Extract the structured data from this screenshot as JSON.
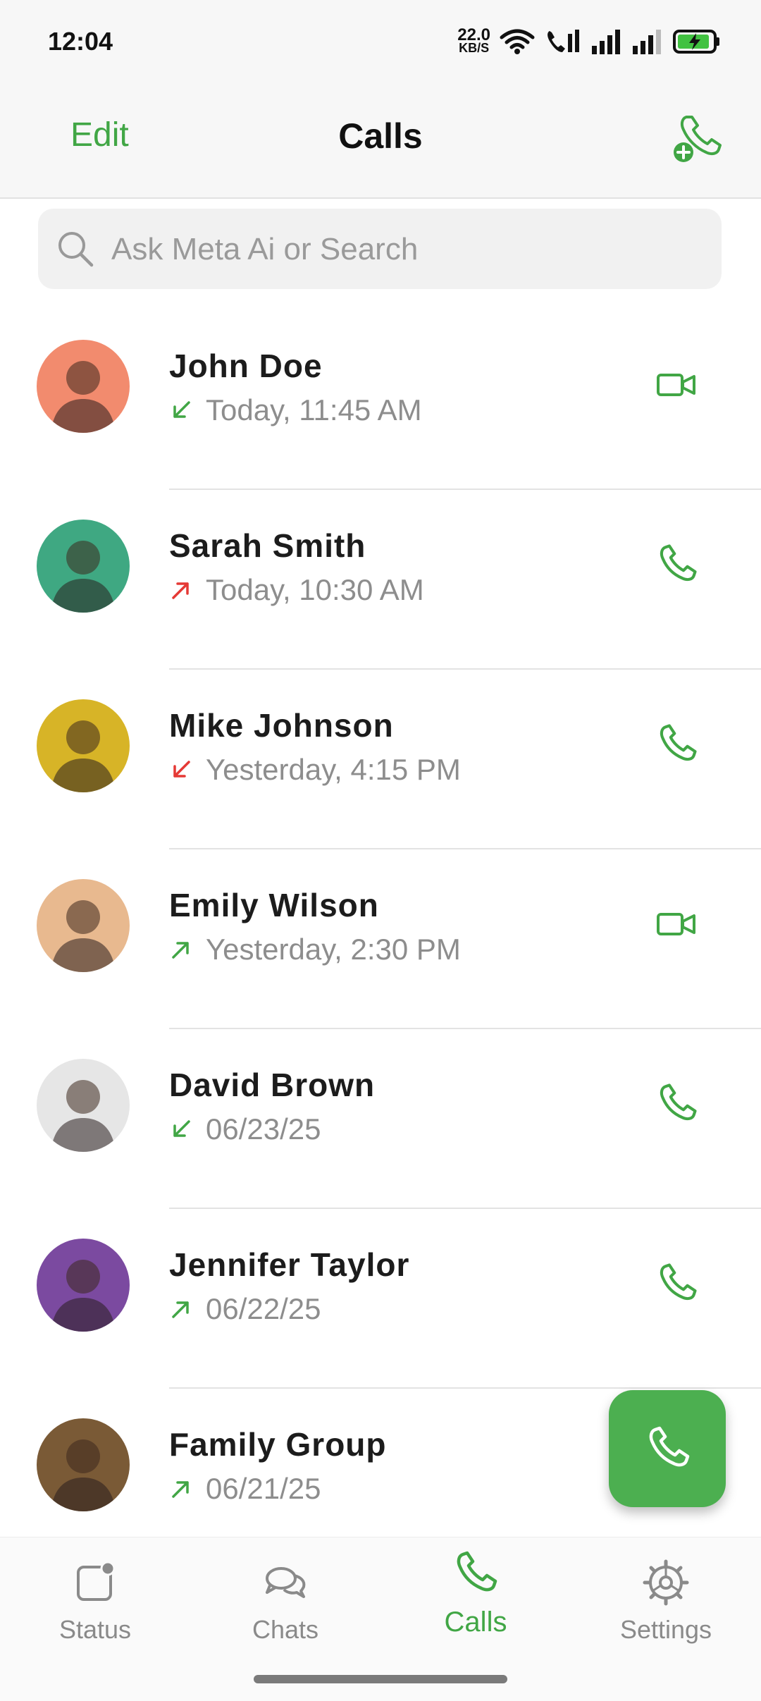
{
  "status_bar": {
    "time": "12:04",
    "net_speed_value": "22.0",
    "net_speed_unit": "KB/S",
    "icons": [
      "wifi-icon",
      "volte-icon",
      "signal-icon",
      "signal-icon",
      "battery-charging-icon"
    ]
  },
  "header": {
    "edit_label": "Edit",
    "title": "Calls",
    "add_call_icon": "add-call-icon"
  },
  "search": {
    "placeholder": "Ask Meta Ai or Search"
  },
  "calls": [
    {
      "name": "John Doe",
      "time": "Today, 11:45 AM",
      "direction": "incoming",
      "direction_color": "#41a645",
      "type": "video",
      "avatar_bg": "#f28b6e"
    },
    {
      "name": "Sarah Smith",
      "time": "Today, 10:30 AM",
      "direction": "outgoing-missed",
      "direction_color": "#e53935",
      "type": "voice",
      "avatar_bg": "#3fa882"
    },
    {
      "name": "Mike Johnson",
      "time": "Yesterday, 4:15 PM",
      "direction": "incoming-missed",
      "direction_color": "#e53935",
      "type": "voice",
      "avatar_bg": "#d7b427"
    },
    {
      "name": "Emily Wilson",
      "time": "Yesterday, 2:30 PM",
      "direction": "outgoing",
      "direction_color": "#41a645",
      "type": "video",
      "avatar_bg": "#e8b98f"
    },
    {
      "name": "David Brown",
      "time": "06/23/25",
      "direction": "incoming",
      "direction_color": "#41a645",
      "type": "voice",
      "avatar_bg": "#e6e6e6"
    },
    {
      "name": "Jennifer Taylor",
      "time": "06/22/25",
      "direction": "outgoing",
      "direction_color": "#41a645",
      "type": "voice",
      "avatar_bg": "#7b4aa0"
    },
    {
      "name": "Family Group",
      "time": "06/21/25",
      "direction": "outgoing",
      "direction_color": "#41a645",
      "type": "voice",
      "avatar_bg": "#7a5a36"
    }
  ],
  "fab": {
    "icon": "phone-icon",
    "color": "#4caf50"
  },
  "bottom_nav": [
    {
      "label": "Status",
      "icon": "status-icon",
      "active": false
    },
    {
      "label": "Chats",
      "icon": "chats-icon",
      "active": false
    },
    {
      "label": "Calls",
      "icon": "calls-icon",
      "active": true
    },
    {
      "label": "Settings",
      "icon": "settings-icon",
      "active": false
    }
  ],
  "colors": {
    "accent": "#41a645",
    "missed": "#e53935",
    "muted": "#8d8d8d"
  }
}
